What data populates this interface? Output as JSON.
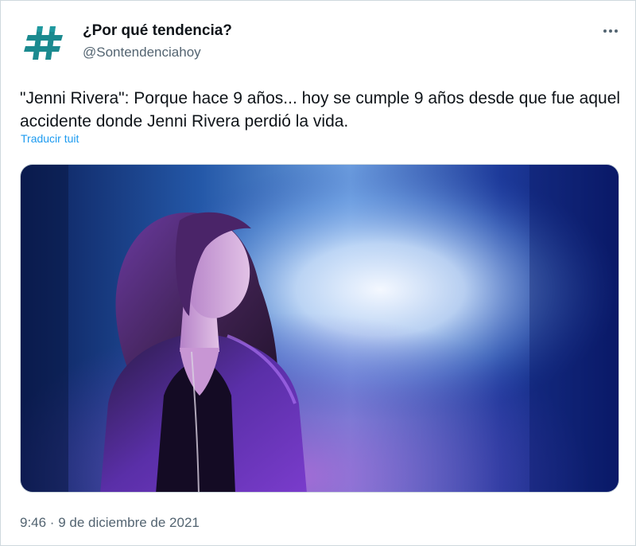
{
  "tweet": {
    "display_name": "¿Por qué tendencia?",
    "handle": "@Sontendenciahoy",
    "text": "\"Jenni Rivera\": Porque hace 9 años... hoy se cumple 9 años desde que fue aquel accidente donde Jenni Rivera perdió la vida.",
    "translate_label": "Traducir tuit",
    "timestamp": "9:46 · 9 de diciembre de 2021"
  },
  "icons": {
    "avatar": "hashtag-icon",
    "more": "more-options-icon"
  },
  "colors": {
    "avatar_teal": "#1b8a8f",
    "link_blue": "#1d9bf0",
    "secondary_text": "#536471",
    "border": "#cfd9de"
  }
}
